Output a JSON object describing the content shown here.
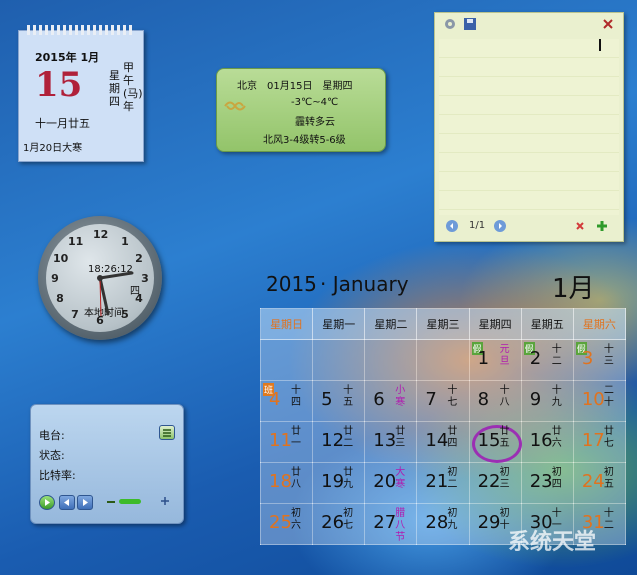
{
  "mini_calendar": {
    "year_month": "2015年 1月",
    "day": "15",
    "weekday": "星期四",
    "ganzhi": "甲午(马)年",
    "lunar": "十一月廿五",
    "next_term": "1月20日大寒"
  },
  "weather": {
    "line1": "北京　01月15日　星期四",
    "temp": "-3℃~4℃",
    "cond": "霾转多云",
    "wind": "北风3-4级转5-6级"
  },
  "clock": {
    "numbers": [
      "12",
      "1",
      "2",
      "3",
      "4",
      "5",
      "6",
      "7",
      "8",
      "9",
      "10",
      "11"
    ],
    "time": "18:26:12",
    "weekday": "四",
    "label": "本地时间"
  },
  "radio": {
    "station": "电台:",
    "status": "状态:",
    "bitrate": "比特率:"
  },
  "notes": {
    "page": "1/1"
  },
  "big_calendar": {
    "year": "2015",
    "month_name": "January",
    "month_cn": "1月",
    "weekdays": [
      "星期日",
      "星期一",
      "星期二",
      "星期三",
      "星期四",
      "星期五",
      "星期六"
    ],
    "weeks": [
      [
        {
          "d": "",
          "l": ""
        },
        {
          "d": "",
          "l": ""
        },
        {
          "d": "",
          "l": ""
        },
        {
          "d": "",
          "l": ""
        },
        {
          "d": "1",
          "l": "元旦",
          "tag": "假",
          "fest": true
        },
        {
          "d": "2",
          "l": "十二",
          "tag": "假"
        },
        {
          "d": "3",
          "l": "十三",
          "tag": "假",
          "we": true
        }
      ],
      [
        {
          "d": "4",
          "l": "十四",
          "tag": "班",
          "we": true
        },
        {
          "d": "5",
          "l": "十五"
        },
        {
          "d": "6",
          "l": "小寒",
          "fest": true
        },
        {
          "d": "7",
          "l": "十七"
        },
        {
          "d": "8",
          "l": "十八"
        },
        {
          "d": "9",
          "l": "十九"
        },
        {
          "d": "10",
          "l": "二十",
          "we": true
        }
      ],
      [
        {
          "d": "11",
          "l": "廿一",
          "we": true
        },
        {
          "d": "12",
          "l": "廿二"
        },
        {
          "d": "13",
          "l": "廿三"
        },
        {
          "d": "14",
          "l": "廿四"
        },
        {
          "d": "15",
          "l": "廿五",
          "today": true
        },
        {
          "d": "16",
          "l": "廿六"
        },
        {
          "d": "17",
          "l": "廿七",
          "we": true
        }
      ],
      [
        {
          "d": "18",
          "l": "廿八",
          "we": true
        },
        {
          "d": "19",
          "l": "廿九"
        },
        {
          "d": "20",
          "l": "大寒",
          "fest": true
        },
        {
          "d": "21",
          "l": "初二"
        },
        {
          "d": "22",
          "l": "初三"
        },
        {
          "d": "23",
          "l": "初四"
        },
        {
          "d": "24",
          "l": "初五",
          "we": true
        }
      ],
      [
        {
          "d": "25",
          "l": "初六",
          "we": true
        },
        {
          "d": "26",
          "l": "初七"
        },
        {
          "d": "27",
          "l": "腊八节",
          "fest": true
        },
        {
          "d": "28",
          "l": "初九"
        },
        {
          "d": "29",
          "l": "初十"
        },
        {
          "d": "30",
          "l": "十一"
        },
        {
          "d": "31",
          "l": "十二",
          "we": true
        }
      ]
    ]
  },
  "watermark": "系统天堂"
}
